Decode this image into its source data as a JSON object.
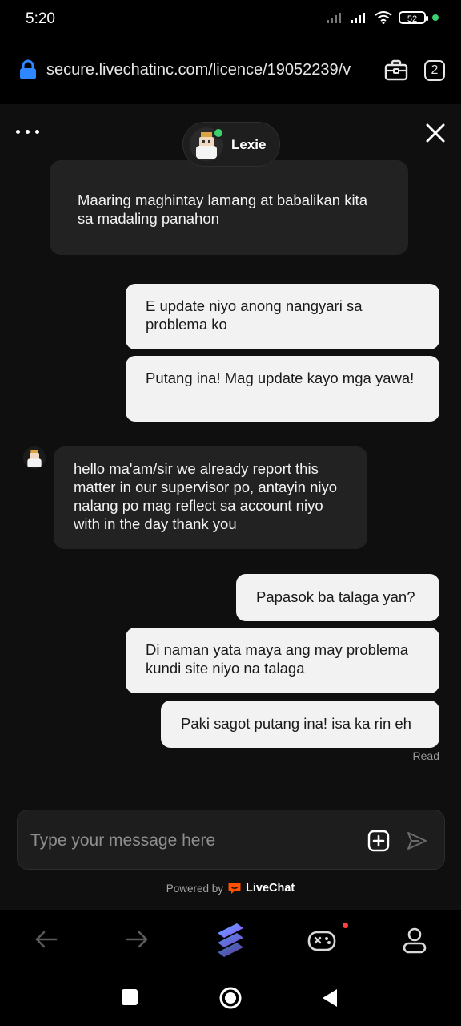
{
  "status_bar": {
    "time": "5:20",
    "battery": "52"
  },
  "browser": {
    "url": "secure.livechatinc.com/licence/19052239/v",
    "tab_count": "2"
  },
  "agent": {
    "name": "Lexie"
  },
  "messages": [
    {
      "from": "agent",
      "text": "Maaring maghintay lamang at babalikan kita sa madaling panahon"
    },
    {
      "from": "user",
      "text": "E update niyo anong nangyari sa problema ko"
    },
    {
      "from": "user",
      "text": "Putang ina! Mag update kayo mga yawa!"
    },
    {
      "from": "agent",
      "text": "hello ma'am/sir we already report this matter in our supervisor po, antayin niyo nalang po mag reflect sa account niyo with in the day thank you"
    },
    {
      "from": "user",
      "text": "Papasok ba talaga yan?"
    },
    {
      "from": "user",
      "text": "Di naman yata maya ang may problema kundi site niyo na talaga"
    },
    {
      "from": "user",
      "text": "Paki sagot putang ina! isa ka rin eh"
    }
  ],
  "read_receipt": "Read",
  "composer": {
    "placeholder": "Type your message here",
    "value": ""
  },
  "footer": {
    "powered_by": "Powered by",
    "brand": "LiveChat"
  },
  "colors": {
    "online": "#3bd16f",
    "livechat_brand": "#ff5100",
    "url_lock": "#2f87ff",
    "notification_dot": "#ff4040"
  },
  "icons": [
    "lock-icon",
    "briefcase-icon",
    "tabs-counter-icon",
    "more-dots-icon",
    "close-icon",
    "attach-plus-icon",
    "send-icon",
    "livechat-logo-icon",
    "back-arrow-icon",
    "forward-arrow-icon",
    "app-logo-icon",
    "gamepad-icon",
    "profile-icon",
    "recents-square-icon",
    "home-circle-icon",
    "back-triangle-icon"
  ]
}
